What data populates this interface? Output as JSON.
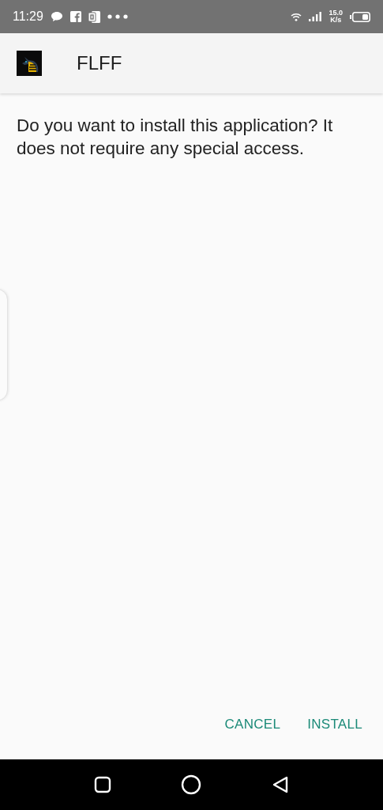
{
  "status_bar": {
    "time": "11:29",
    "speed_value": "15.0",
    "speed_unit": "K/s"
  },
  "header": {
    "app_name": "FLFF"
  },
  "message": "Do you want to install this application? It does not require any special access.",
  "buttons": [
    {
      "label": "CANCEL"
    },
    {
      "label": "INSTALL"
    }
  ]
}
